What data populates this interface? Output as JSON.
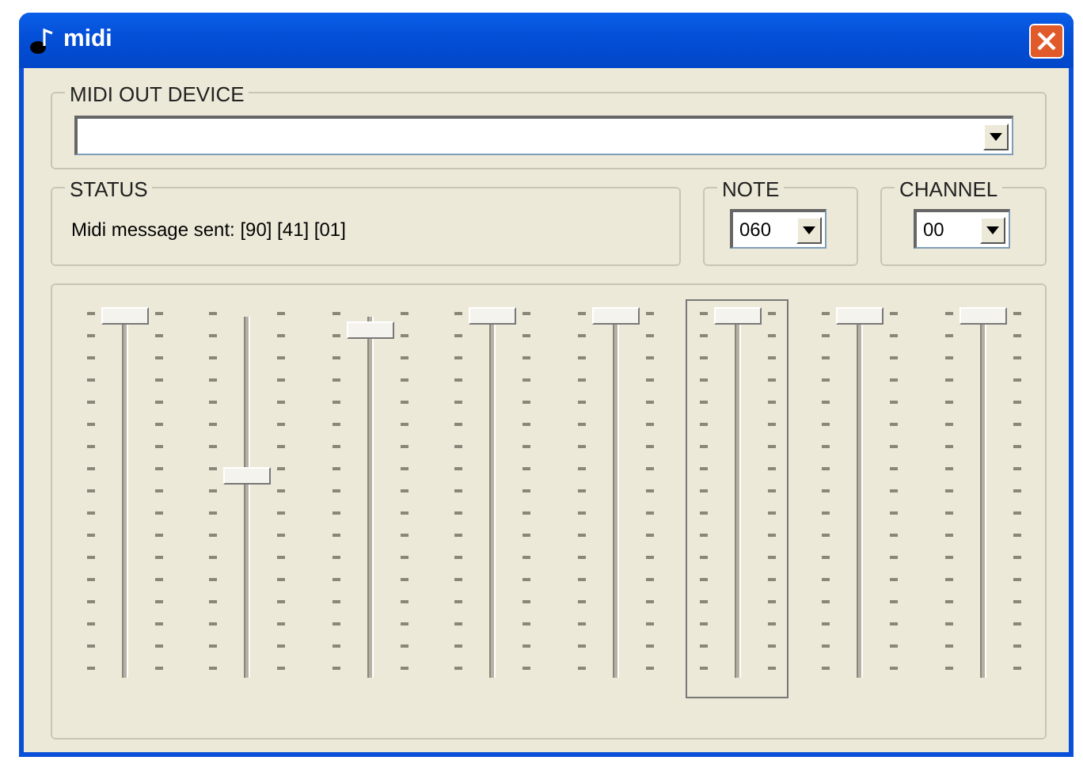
{
  "window": {
    "title": "midi"
  },
  "midi_out_device": {
    "label": "MIDI OUT DEVICE"
  },
  "status": {
    "label": "STATUS",
    "message": "Midi message sent: [90] [41] [01]"
  },
  "note": {
    "label": "NOTE",
    "value": "060"
  },
  "channel": {
    "label": "CHANNEL",
    "value": "00"
  },
  "sliders": [
    {
      "level": 1,
      "focused": false
    },
    {
      "level": 0.55,
      "focused": false
    },
    {
      "level": 0.96,
      "focused": false
    },
    {
      "level": 1,
      "focused": false
    },
    {
      "level": 1,
      "focused": false
    },
    {
      "level": 1,
      "focused": true
    },
    {
      "level": 1,
      "focused": false
    },
    {
      "level": 1,
      "focused": false
    }
  ]
}
